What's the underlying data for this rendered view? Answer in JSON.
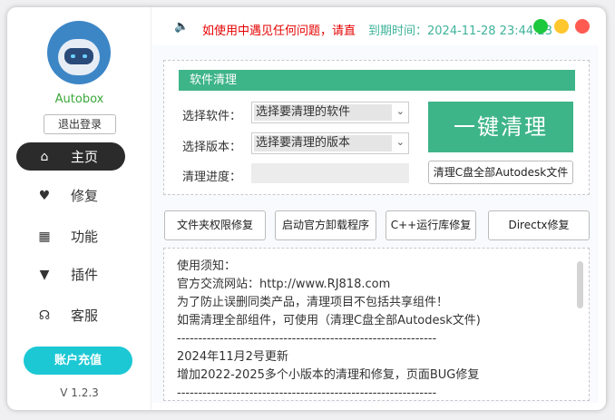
{
  "sidebar": {
    "brand": "Autobox",
    "logout": "退出登录",
    "items": [
      {
        "label": "主页",
        "icon": "home-icon",
        "active": true
      },
      {
        "label": "修复",
        "icon": "heart-icon"
      },
      {
        "label": "功能",
        "icon": "grid-icon"
      },
      {
        "label": "插件",
        "icon": "plugin-icon"
      },
      {
        "label": "客服",
        "icon": "headset-icon"
      }
    ],
    "recharge": "账户充值",
    "version": "V 1.2.3"
  },
  "topbar": {
    "notice": "如使用中遇见任何问题，请直",
    "expire": "到期时间：2024-11-28 23:44:23",
    "window_dots": [
      "#1cc83d",
      "#ffc72e",
      "#ff5b52"
    ]
  },
  "clean": {
    "title": "软件清理",
    "software_label": "选择软件：",
    "software_value": "选择要清理的软件",
    "version_label": "选择版本：",
    "version_value": "选择要清理的版本",
    "progress_label": "清理进度：",
    "progress": 0,
    "one_click": "一键清理",
    "clean_all": "清理C盘全部Autodesk文件"
  },
  "tools": [
    "文件夹权限修复",
    "启动官方卸载程序",
    "C++运行库修复",
    "Directx修复"
  ],
  "notes": [
    "使用须知：",
    "官方交流网站：http://www.RJ818.com",
    "为了防止误删同类产品，清理项目不包括共享组件！",
    "如需清理全部组件，可使用（清理C盘全部Autodesk文件)",
    "-------------------------------------------------------------",
    "2024年11月2号更新",
    "增加2022-2025多个小版本的清理和修复，页面BUG修复",
    "-------------------------------------------------------------"
  ],
  "colors": {
    "accent": "#3eb489",
    "recharge": "#1bc8d4",
    "notice": "#e60000"
  }
}
